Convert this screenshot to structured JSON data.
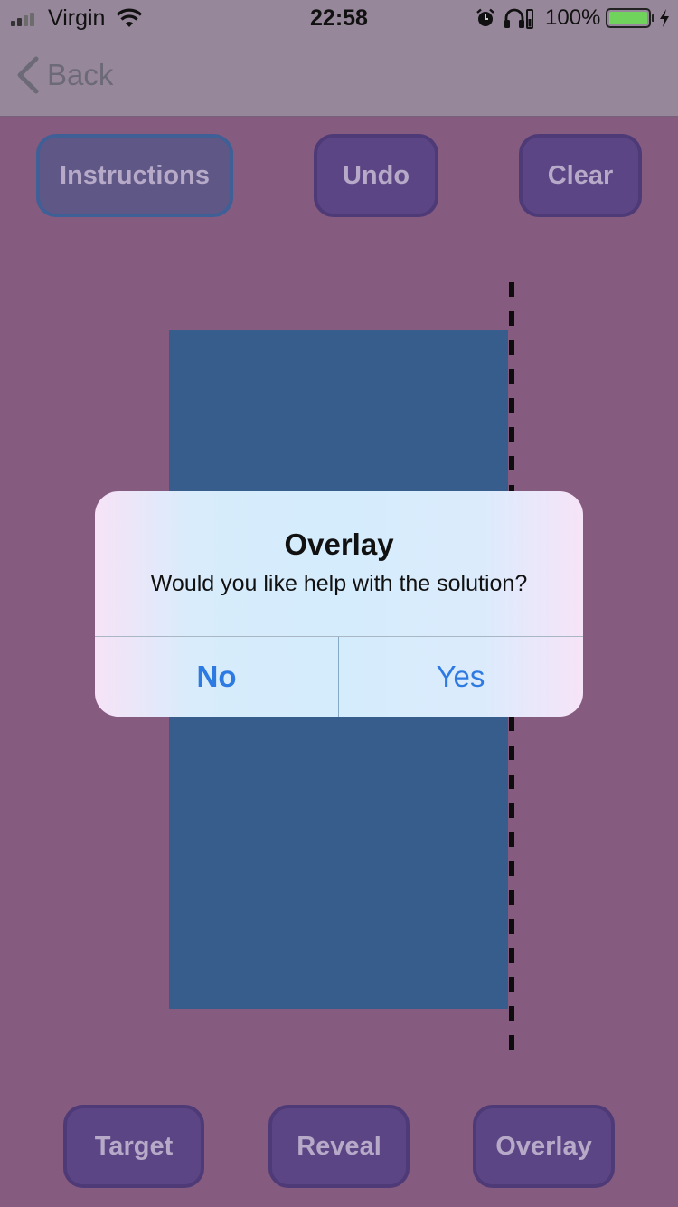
{
  "status_bar": {
    "carrier": "Virgin",
    "time": "22:58",
    "battery": "100%"
  },
  "nav": {
    "back_label": "Back"
  },
  "top_buttons": {
    "instructions": "Instructions",
    "undo": "Undo",
    "clear": "Clear"
  },
  "bottom_buttons": {
    "target": "Target",
    "reveal": "Reveal",
    "overlay": "Overlay"
  },
  "alert": {
    "title": "Overlay",
    "message": "Would you like help with the solution?",
    "no_label": "No",
    "yes_label": "Yes"
  },
  "colors": {
    "background": "#865b80",
    "button": "#5c4584",
    "shape": "#365d8b",
    "accent": "#2d7ae2"
  }
}
